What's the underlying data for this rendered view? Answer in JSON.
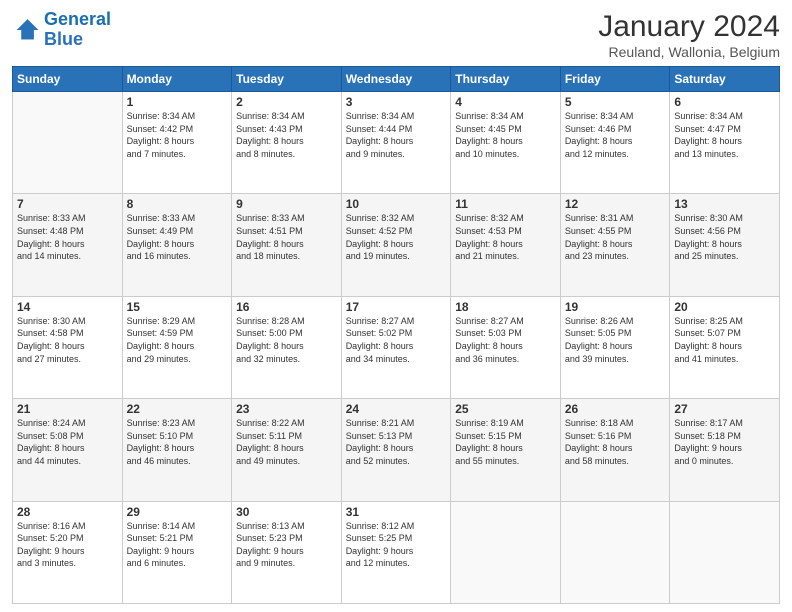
{
  "header": {
    "logo_line1": "General",
    "logo_line2": "Blue",
    "month": "January 2024",
    "location": "Reuland, Wallonia, Belgium"
  },
  "weekdays": [
    "Sunday",
    "Monday",
    "Tuesday",
    "Wednesday",
    "Thursday",
    "Friday",
    "Saturday"
  ],
  "weeks": [
    [
      {
        "day": "",
        "info": ""
      },
      {
        "day": "1",
        "info": "Sunrise: 8:34 AM\nSunset: 4:42 PM\nDaylight: 8 hours\nand 7 minutes."
      },
      {
        "day": "2",
        "info": "Sunrise: 8:34 AM\nSunset: 4:43 PM\nDaylight: 8 hours\nand 8 minutes."
      },
      {
        "day": "3",
        "info": "Sunrise: 8:34 AM\nSunset: 4:44 PM\nDaylight: 8 hours\nand 9 minutes."
      },
      {
        "day": "4",
        "info": "Sunrise: 8:34 AM\nSunset: 4:45 PM\nDaylight: 8 hours\nand 10 minutes."
      },
      {
        "day": "5",
        "info": "Sunrise: 8:34 AM\nSunset: 4:46 PM\nDaylight: 8 hours\nand 12 minutes."
      },
      {
        "day": "6",
        "info": "Sunrise: 8:34 AM\nSunset: 4:47 PM\nDaylight: 8 hours\nand 13 minutes."
      }
    ],
    [
      {
        "day": "7",
        "info": "Sunrise: 8:33 AM\nSunset: 4:48 PM\nDaylight: 8 hours\nand 14 minutes."
      },
      {
        "day": "8",
        "info": "Sunrise: 8:33 AM\nSunset: 4:49 PM\nDaylight: 8 hours\nand 16 minutes."
      },
      {
        "day": "9",
        "info": "Sunrise: 8:33 AM\nSunset: 4:51 PM\nDaylight: 8 hours\nand 18 minutes."
      },
      {
        "day": "10",
        "info": "Sunrise: 8:32 AM\nSunset: 4:52 PM\nDaylight: 8 hours\nand 19 minutes."
      },
      {
        "day": "11",
        "info": "Sunrise: 8:32 AM\nSunset: 4:53 PM\nDaylight: 8 hours\nand 21 minutes."
      },
      {
        "day": "12",
        "info": "Sunrise: 8:31 AM\nSunset: 4:55 PM\nDaylight: 8 hours\nand 23 minutes."
      },
      {
        "day": "13",
        "info": "Sunrise: 8:30 AM\nSunset: 4:56 PM\nDaylight: 8 hours\nand 25 minutes."
      }
    ],
    [
      {
        "day": "14",
        "info": "Sunrise: 8:30 AM\nSunset: 4:58 PM\nDaylight: 8 hours\nand 27 minutes."
      },
      {
        "day": "15",
        "info": "Sunrise: 8:29 AM\nSunset: 4:59 PM\nDaylight: 8 hours\nand 29 minutes."
      },
      {
        "day": "16",
        "info": "Sunrise: 8:28 AM\nSunset: 5:00 PM\nDaylight: 8 hours\nand 32 minutes."
      },
      {
        "day": "17",
        "info": "Sunrise: 8:27 AM\nSunset: 5:02 PM\nDaylight: 8 hours\nand 34 minutes."
      },
      {
        "day": "18",
        "info": "Sunrise: 8:27 AM\nSunset: 5:03 PM\nDaylight: 8 hours\nand 36 minutes."
      },
      {
        "day": "19",
        "info": "Sunrise: 8:26 AM\nSunset: 5:05 PM\nDaylight: 8 hours\nand 39 minutes."
      },
      {
        "day": "20",
        "info": "Sunrise: 8:25 AM\nSunset: 5:07 PM\nDaylight: 8 hours\nand 41 minutes."
      }
    ],
    [
      {
        "day": "21",
        "info": "Sunrise: 8:24 AM\nSunset: 5:08 PM\nDaylight: 8 hours\nand 44 minutes."
      },
      {
        "day": "22",
        "info": "Sunrise: 8:23 AM\nSunset: 5:10 PM\nDaylight: 8 hours\nand 46 minutes."
      },
      {
        "day": "23",
        "info": "Sunrise: 8:22 AM\nSunset: 5:11 PM\nDaylight: 8 hours\nand 49 minutes."
      },
      {
        "day": "24",
        "info": "Sunrise: 8:21 AM\nSunset: 5:13 PM\nDaylight: 8 hours\nand 52 minutes."
      },
      {
        "day": "25",
        "info": "Sunrise: 8:19 AM\nSunset: 5:15 PM\nDaylight: 8 hours\nand 55 minutes."
      },
      {
        "day": "26",
        "info": "Sunrise: 8:18 AM\nSunset: 5:16 PM\nDaylight: 8 hours\nand 58 minutes."
      },
      {
        "day": "27",
        "info": "Sunrise: 8:17 AM\nSunset: 5:18 PM\nDaylight: 9 hours\nand 0 minutes."
      }
    ],
    [
      {
        "day": "28",
        "info": "Sunrise: 8:16 AM\nSunset: 5:20 PM\nDaylight: 9 hours\nand 3 minutes."
      },
      {
        "day": "29",
        "info": "Sunrise: 8:14 AM\nSunset: 5:21 PM\nDaylight: 9 hours\nand 6 minutes."
      },
      {
        "day": "30",
        "info": "Sunrise: 8:13 AM\nSunset: 5:23 PM\nDaylight: 9 hours\nand 9 minutes."
      },
      {
        "day": "31",
        "info": "Sunrise: 8:12 AM\nSunset: 5:25 PM\nDaylight: 9 hours\nand 12 minutes."
      },
      {
        "day": "",
        "info": ""
      },
      {
        "day": "",
        "info": ""
      },
      {
        "day": "",
        "info": ""
      }
    ]
  ]
}
